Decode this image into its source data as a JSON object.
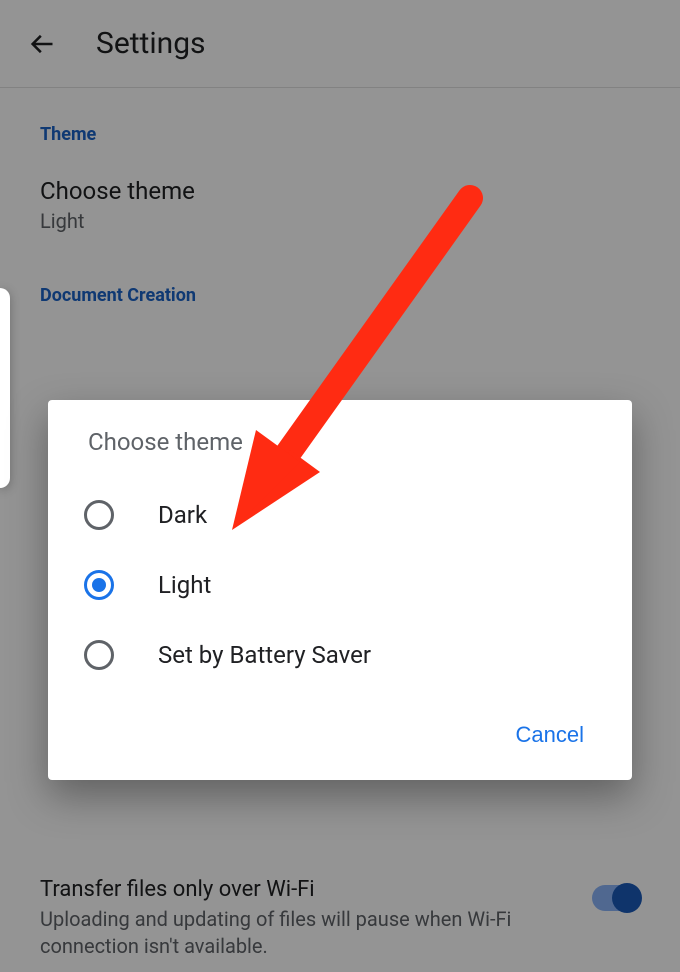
{
  "appbar": {
    "title": "Settings"
  },
  "sections": {
    "theme": {
      "label": "Theme",
      "choose_title": "Choose theme",
      "choose_value": "Light"
    },
    "doc": {
      "label": "Document Creation"
    },
    "wifi": {
      "title": "Transfer files only over Wi-Fi",
      "sub": "Uploading and updating of files will pause when Wi-Fi connection isn't available."
    }
  },
  "dialog": {
    "title": "Choose theme",
    "options": [
      {
        "label": "Dark",
        "selected": false
      },
      {
        "label": "Light",
        "selected": true
      },
      {
        "label": "Set by Battery Saver",
        "selected": false
      }
    ],
    "cancel": "Cancel"
  }
}
